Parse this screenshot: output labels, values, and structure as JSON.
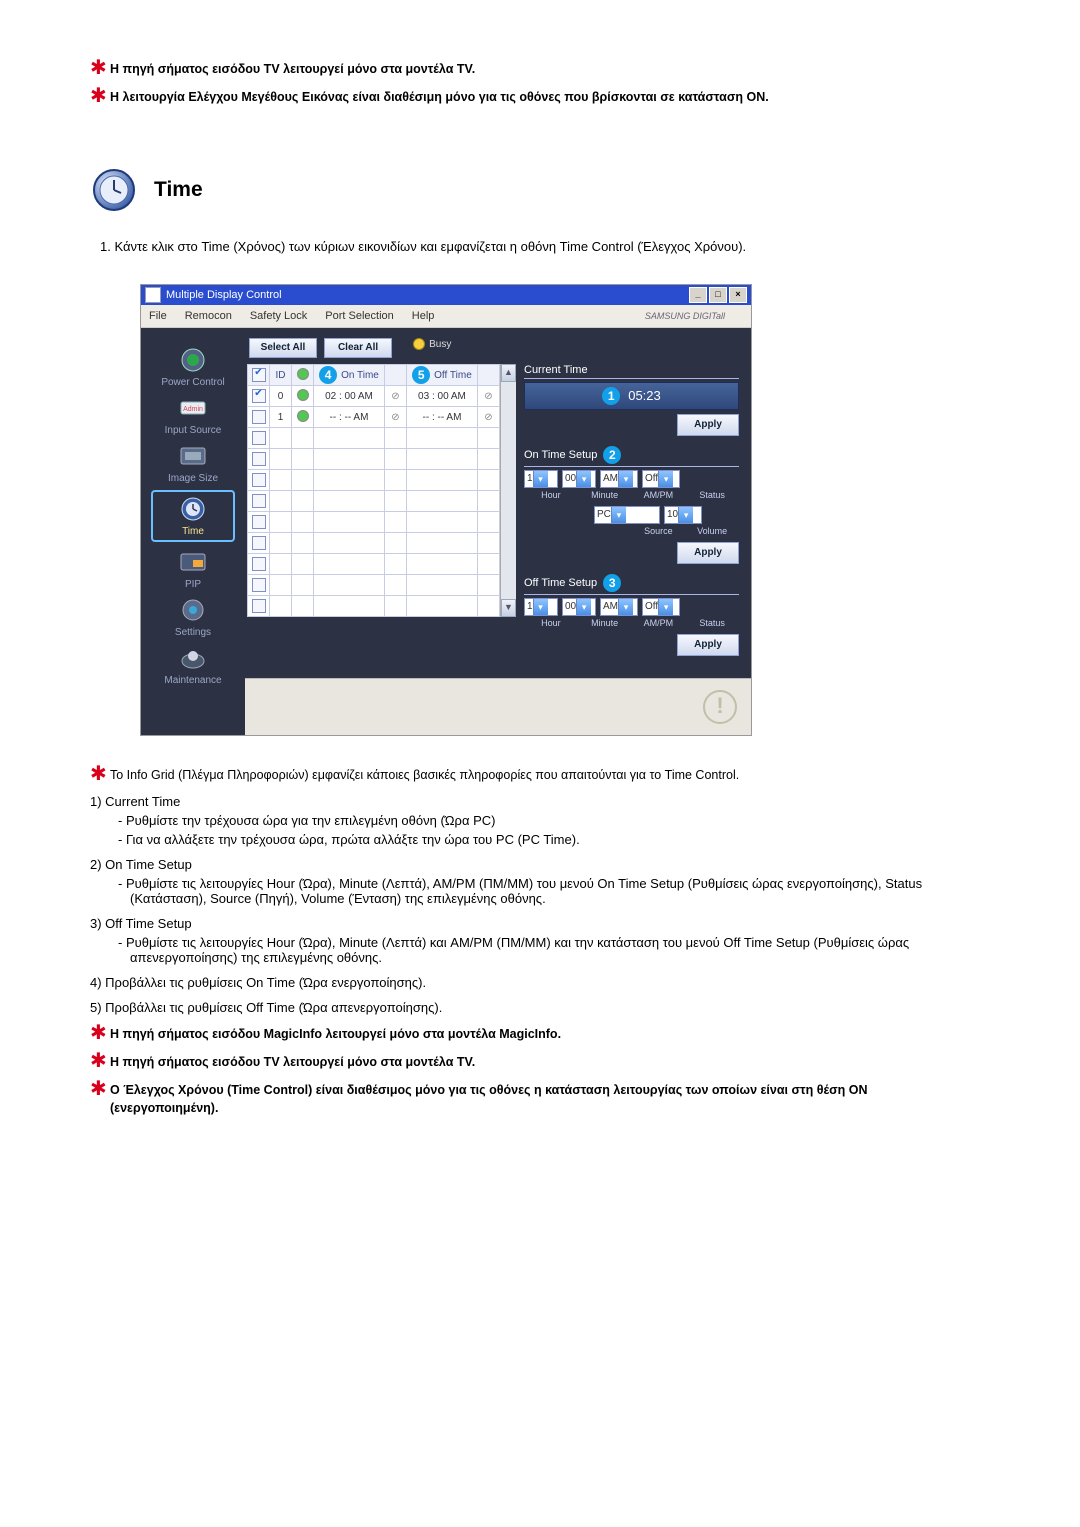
{
  "top_notes": [
    "Η πηγή σήματος εισόδου TV λειτουργεί μόνο στα μοντέλα TV.",
    "Η λειτουργία Ελέγχου Μεγέθους Εικόνας είναι διαθέσιμη μόνο για τις οθόνες που βρίσκονται σε κατάσταση ON."
  ],
  "section_title": "Time",
  "step1": "1.  Κάντε κλικ στο Time (Χρόνος) των κύριων εικονιδίων και εμφανίζεται η οθόνη Time Control (Έλεγχος Χρόνου).",
  "app": {
    "title": "Multiple Display Control",
    "menus": [
      "File",
      "Remocon",
      "Safety Lock",
      "Port Selection",
      "Help"
    ],
    "brand": "SAMSUNG DIGITall",
    "sidebar": [
      {
        "label": "Power Control"
      },
      {
        "label": "Input Source"
      },
      {
        "label": "Image Size"
      },
      {
        "label": "Time",
        "active": true
      },
      {
        "label": "PIP"
      },
      {
        "label": "Settings"
      },
      {
        "label": "Maintenance"
      }
    ],
    "buttons": {
      "select_all": "Select All",
      "clear_all": "Clear All",
      "busy": "Busy",
      "apply": "Apply"
    },
    "table": {
      "headers": {
        "chk": "",
        "id": "ID",
        "pw": "",
        "on": "On Time",
        "off": "Off Time"
      },
      "badge_on": "4",
      "badge_off": "5",
      "rows": [
        {
          "chk": true,
          "id": "0",
          "pw": "green",
          "on": "02 : 00 AM",
          "onled": "⊘",
          "off": "03 : 00 AM",
          "offled": "⊘"
        },
        {
          "chk": false,
          "id": "1",
          "pw": "green",
          "on": "-- : -- AM",
          "onled": "⊘",
          "off": "-- : -- AM",
          "offled": "⊘"
        },
        {
          "chk": false,
          "id": "",
          "pw": "",
          "on": "",
          "onled": "",
          "off": "",
          "offled": ""
        },
        {
          "chk": false,
          "id": "",
          "pw": "",
          "on": "",
          "onled": "",
          "off": "",
          "offled": ""
        },
        {
          "chk": false,
          "id": "",
          "pw": "",
          "on": "",
          "onled": "",
          "off": "",
          "offled": ""
        },
        {
          "chk": false,
          "id": "",
          "pw": "",
          "on": "",
          "onled": "",
          "off": "",
          "offled": ""
        },
        {
          "chk": false,
          "id": "",
          "pw": "",
          "on": "",
          "onled": "",
          "off": "",
          "offled": ""
        },
        {
          "chk": false,
          "id": "",
          "pw": "",
          "on": "",
          "onled": "",
          "off": "",
          "offled": ""
        },
        {
          "chk": false,
          "id": "",
          "pw": "",
          "on": "",
          "onled": "",
          "off": "",
          "offled": ""
        },
        {
          "chk": false,
          "id": "",
          "pw": "",
          "on": "",
          "onled": "",
          "off": "",
          "offled": ""
        },
        {
          "chk": false,
          "id": "",
          "pw": "",
          "on": "",
          "onled": "",
          "off": "",
          "offled": ""
        }
      ]
    },
    "right": {
      "current_label": "Current Time",
      "current_badge": "1",
      "current_value": "05:23",
      "on_setup": "On Time Setup",
      "on_badge": "2",
      "on_fields": {
        "hour": "1",
        "minute": "00",
        "ampm": "AM",
        "status": "Off",
        "source": "PC",
        "volume": "10"
      },
      "on_sub": [
        "Hour",
        "Minute",
        "AM/PM",
        "Status"
      ],
      "on_sub2": [
        "",
        "",
        "Source",
        "Volume"
      ],
      "off_setup": "Off Time Setup",
      "off_badge": "3",
      "off_fields": {
        "hour": "1",
        "minute": "00",
        "ampm": "AM",
        "status": "Off"
      },
      "off_sub": [
        "Hour",
        "Minute",
        "AM/PM",
        "Status"
      ]
    }
  },
  "body_notes": {
    "info_grid": "Το Info Grid (Πλέγμα Πληροφοριών) εμφανίζει κάποιες βασικές πληροφορίες που απαιτούνται για το Time Control.",
    "l1": "1)  Current Time",
    "l1a": "Ρυθμίστε την τρέχουσα ώρα για την επιλεγμένη οθόνη (Ώρα PC)",
    "l1b": "Για να αλλάξετε την τρέχουσα ώρα, πρώτα αλλάξτε την ώρα του PC (PC Time).",
    "l2": "2)  On Time Setup",
    "l2a": "Ρυθμίστε τις λειτουργίες Hour (Ώρα), Minute (Λεπτά), AM/PM (ΠΜ/ΜΜ) του μενού On Time Setup (Ρυθμίσεις ώρας ενεργοποίησης), Status (Κατάσταση), Source (Πηγή), Volume (Ένταση) της επιλεγμένης οθόνης.",
    "l3": "3)  Off Time Setup",
    "l3a": "Ρυθμίστε τις λειτουργίες Hour (Ώρα), Minute (Λεπτά) και AM/PM (ΠΜ/ΜΜ) και την κατάσταση του μενού Off Time Setup (Ρυθμίσεις ώρας απενεργοποίησης) της επιλεγμένης οθόνης.",
    "l4": "4)  Προβάλλει τις ρυθμίσεις On Time (Ώρα ενεργοποίησης).",
    "l5": "5)  Προβάλλει τις ρυθμίσεις Off Time (Ώρα απενεργοποίησης)."
  },
  "bottom_notes": [
    "Η πηγή σήματος εισόδου MagicInfo λειτουργεί μόνο στα μοντέλα MagicInfo.",
    "Η πηγή σήματος εισόδου TV λειτουργεί μόνο στα μοντέλα TV.",
    "Ο Έλεγχος Χρόνου (Time Control) είναι διαθέσιμος μόνο για τις οθόνες η κατάσταση λειτουργίας των οποίων είναι στη θέση ON (ενεργοποιημένη)."
  ]
}
